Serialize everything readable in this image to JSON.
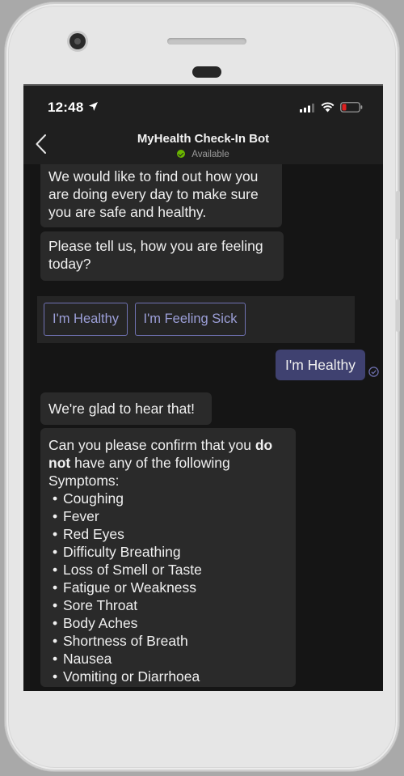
{
  "status_bar": {
    "time": "12:48"
  },
  "header": {
    "bot_name": "MyHealth Check-In Bot",
    "presence": "Available"
  },
  "messages": {
    "intro": "We would like to find out how you are doing every day to make sure you are safe and healthy.",
    "question": "Please tell us, how you are feeling today?",
    "user_reply": "I'm Healthy",
    "glad": "We're glad to hear that!",
    "confirm_prefix": "Can you please confirm that you",
    "confirm_do": "do",
    "confirm_not": "not",
    "confirm_suffix": "have any of the following Symptoms:",
    "symptoms": [
      "Coughing",
      "Fever",
      "Red Eyes",
      "Difficulty Breathing",
      "Loss of Smell or Taste",
      "Fatigue or Weakness",
      "Sore Throat",
      "Body Aches",
      "Shortness of Breath",
      "Nausea",
      "Vomiting or Diarrhoea"
    ]
  },
  "actions": {
    "healthy_label": "I'm Healthy",
    "sick_label": "I'm Feeling Sick"
  },
  "colors": {
    "accent": "#7173b4",
    "user_bubble": "#3f4170",
    "presence": "#6bb700",
    "battery_low": "#e02020"
  },
  "icons": {
    "location": "location-arrow-icon",
    "signal": "cellular-signal-icon",
    "wifi": "wifi-icon",
    "battery": "battery-low-icon",
    "back": "chevron-left-icon",
    "sent": "sent-check-icon"
  }
}
